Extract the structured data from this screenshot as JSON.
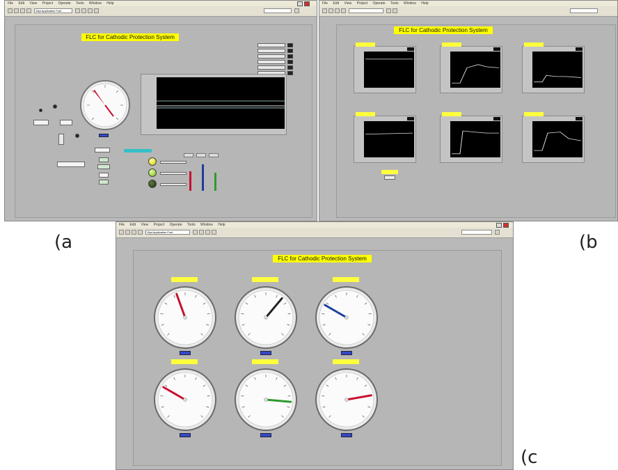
{
  "panel_a": {
    "menu": [
      "File",
      "Edit",
      "View",
      "Project",
      "Operate",
      "Tools",
      "Window",
      "Help"
    ],
    "toolbar_font": "15pt Application Font",
    "title": "FLC for Cathodic Protection System",
    "caption": "(a"
  },
  "panel_b": {
    "menu": [
      "File",
      "Edit",
      "View",
      "Project",
      "Operate",
      "Tools",
      "Window",
      "Help"
    ],
    "title": "FLC for Cathodic Protection System",
    "caption": "(b"
  },
  "panel_c": {
    "menu": [
      "File",
      "Edit",
      "View",
      "Project",
      "Operate",
      "Tools",
      "Window",
      "Help"
    ],
    "toolbar_font": "15pt Application Font",
    "title": "FLC for Cathodic Protection System",
    "caption": "(c",
    "gauges": [
      {
        "needle_deg": -20,
        "color": "#c8102e"
      },
      {
        "needle_deg": 40,
        "color": "#222222"
      },
      {
        "needle_deg": -60,
        "color": "#1d3c9c"
      },
      {
        "needle_deg": -60,
        "color": "#c8102e"
      },
      {
        "needle_deg": 95,
        "color": "#2e9b2e"
      },
      {
        "needle_deg": 80,
        "color": "#c8102e"
      }
    ]
  },
  "colors": {
    "panel_gray": "#b9b9b9",
    "label_yellow": "#ffff00",
    "tag_blue": "#3547c9",
    "plot_black": "#000000",
    "trace_white": "#dcdcdc"
  },
  "icons": [
    "run-arrow-icon",
    "run-continuous-icon",
    "abort-icon",
    "pause-icon",
    "close-icon",
    "minimize-icon",
    "maximize-icon"
  ]
}
